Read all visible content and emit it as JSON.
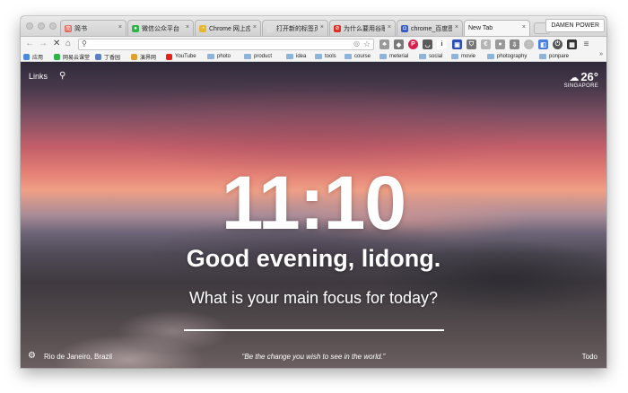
{
  "tabs": [
    {
      "title": "简书",
      "favicon_color": "#e0655a",
      "favicon_glyph": "简"
    },
    {
      "title": "微信公众平台",
      "favicon_color": "#2fb44a",
      "favicon_glyph": "●"
    },
    {
      "title": "Chrome 网上应用店",
      "favicon_color": "#e8b730",
      "favicon_glyph": "◔"
    },
    {
      "title": "打开新的标签页",
      "favicon_color": "#dddddd",
      "favicon_glyph": ""
    },
    {
      "title": "为什么要用谷歌浏览器",
      "favicon_color": "#d93025",
      "favicon_glyph": "⊘"
    },
    {
      "title": "chrome_百度图片",
      "favicon_color": "#3a5cc7",
      "favicon_glyph": "◘"
    },
    {
      "title": "New Tab",
      "favicon_color": "",
      "favicon_glyph": ""
    }
  ],
  "tab_close_glyph": "×",
  "profile_name": "DAMEN POWER",
  "nav": {
    "back": "←",
    "forward": "→",
    "stop": "✕",
    "home": "⌂"
  },
  "address": {
    "value": "",
    "placeholder": ""
  },
  "bookmarks": [
    {
      "label": "应用",
      "icon": "apps-icon",
      "color": "#4a89dc"
    },
    {
      "label": "网易云课堂",
      "icon": "netease-icon",
      "color": "#2fb44a"
    },
    {
      "label": "丁香园",
      "icon": "dxy-icon",
      "color": "#5b7fc4"
    },
    {
      "label": "演界网",
      "icon": "yanjie-icon",
      "color": "#e0a030"
    },
    {
      "label": "YouTube",
      "icon": "youtube-icon",
      "color": "#e62117"
    },
    {
      "label": "photo",
      "icon": "folder-icon",
      "color": ""
    },
    {
      "label": "product",
      "icon": "folder-icon",
      "color": ""
    },
    {
      "label": "idea",
      "icon": "folder-icon",
      "color": ""
    },
    {
      "label": "tools",
      "icon": "folder-icon",
      "color": ""
    },
    {
      "label": "course",
      "icon": "folder-icon",
      "color": ""
    },
    {
      "label": "meterial",
      "icon": "folder-icon",
      "color": ""
    },
    {
      "label": "social",
      "icon": "folder-icon",
      "color": ""
    },
    {
      "label": "movie",
      "icon": "folder-icon",
      "color": ""
    },
    {
      "label": "photography",
      "icon": "folder-icon",
      "color": ""
    },
    {
      "label": "ponpare",
      "icon": "folder-icon",
      "color": ""
    }
  ],
  "bookmarks_more": "»",
  "momentum": {
    "links_label": "Links",
    "weather_temp": "26°",
    "weather_location": "SINGAPORE",
    "time": "11:10",
    "greeting": "Good evening, lidong.",
    "focus_prompt": "What is your main focus for today?",
    "photo_location": "Rio de Janeiro, Brazil",
    "quote": "“Be the change you wish to see in the world.”",
    "todo_label": "Todo"
  }
}
